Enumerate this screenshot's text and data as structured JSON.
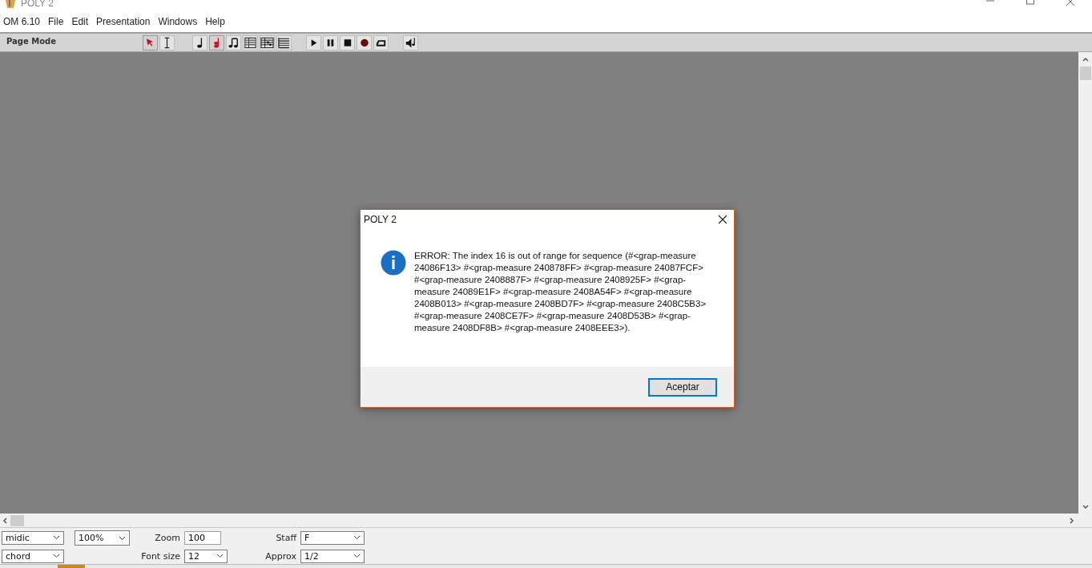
{
  "window": {
    "title": "POLY 2"
  },
  "menu": [
    "OM 6.10",
    "File",
    "Edit",
    "Presentation",
    "Windows",
    "Help"
  ],
  "toolbar": {
    "mode": "Page Mode",
    "groups": [
      [
        {
          "kind": "arrow",
          "selected": true
        },
        {
          "kind": "cursor",
          "selected": false
        }
      ],
      [
        {
          "kind": "note",
          "selected": false
        },
        {
          "kind": "chord",
          "selected": true
        },
        {
          "kind": "beamed",
          "selected": false
        },
        {
          "kind": "list",
          "selected": false
        },
        {
          "kind": "score",
          "selected": false
        },
        {
          "kind": "staff",
          "selected": false
        }
      ],
      [
        {
          "kind": "play",
          "selected": false
        },
        {
          "kind": "pause",
          "selected": false
        },
        {
          "kind": "stop",
          "selected": false
        },
        {
          "kind": "record",
          "selected": false
        },
        {
          "kind": "loop",
          "selected": false
        }
      ],
      [
        {
          "kind": "speaker",
          "selected": false
        }
      ]
    ]
  },
  "dialog": {
    "title": "POLY 2",
    "message": "ERROR: The index 16 is out of range for sequence (#<grap-measure 24086F13> #<grap-measure 240878FF> #<grap-measure 24087FCF> #<grap-measure 2408887F> #<grap-measure 2408925F> #<grap-measure 24089E1F> #<grap-measure 2408A54F> #<grap-measure 2408B013> #<grap-measure 2408BD7F> #<grap-measure 2408C5B3> #<grap-measure 2408CE7F> #<grap-measure 2408D53B> #<grap-measure 2408DF8B> #<grap-measure 2408EEE3>).",
    "button": "Aceptar"
  },
  "controls": {
    "mode_a": "midic",
    "mode_b": "chord",
    "scale": "100%",
    "zoom_label": "Zoom",
    "zoom": "100",
    "font_size_label": "Font size",
    "font_size": "12",
    "staff_label": "Staff",
    "staff": "F",
    "approx_label": "Approx",
    "approx": "1/2"
  }
}
